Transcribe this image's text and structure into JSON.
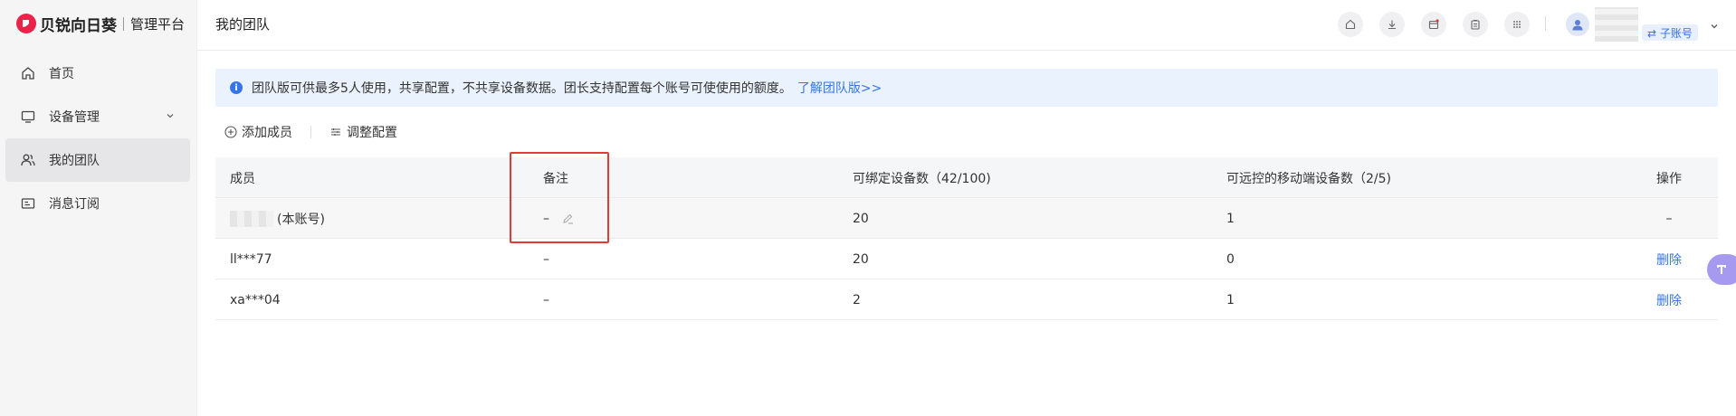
{
  "app": {
    "brand": "贝锐向日葵",
    "subtitle": "管理平台"
  },
  "sidebar": {
    "items": [
      {
        "label": "首页",
        "icon": "home-icon"
      },
      {
        "label": "设备管理",
        "icon": "monitor-icon"
      },
      {
        "label": "我的团队",
        "icon": "team-icon",
        "active": true
      },
      {
        "label": "消息订阅",
        "icon": "message-icon"
      }
    ]
  },
  "header": {
    "title": "我的团队",
    "icons": [
      "home-icon",
      "download-icon",
      "calendar-icon",
      "clipboard-icon",
      "apps-grid-icon"
    ],
    "account_badge": "⇄ 子账号"
  },
  "banner": {
    "text": "团队版可供最多5人使用，共享配置，不共享设备数据。团长支持配置每个账号可使使用的额度。",
    "link": "了解团队版>>"
  },
  "toolbar": {
    "add_member": "添加成员",
    "adjust_config": "调整配置"
  },
  "table": {
    "columns": [
      "成员",
      "备注",
      "可绑定设备数（42/100)",
      "可远控的移动端设备数（2/5)",
      "操作"
    ],
    "rows": [
      {
        "member": "(本账号)",
        "note": "–",
        "devices": "20",
        "mobile": "1",
        "action": "–"
      },
      {
        "member": "ll***77",
        "note": "–",
        "devices": "20",
        "mobile": "0",
        "action": "删除"
      },
      {
        "member": "xa***04",
        "note": "–",
        "devices": "2",
        "mobile": "1",
        "action": "删除"
      }
    ]
  },
  "colors": {
    "accent": "#3575e8",
    "brand": "#e8244a",
    "highlight": "#e53935",
    "banner_bg": "#eaf3fd"
  }
}
